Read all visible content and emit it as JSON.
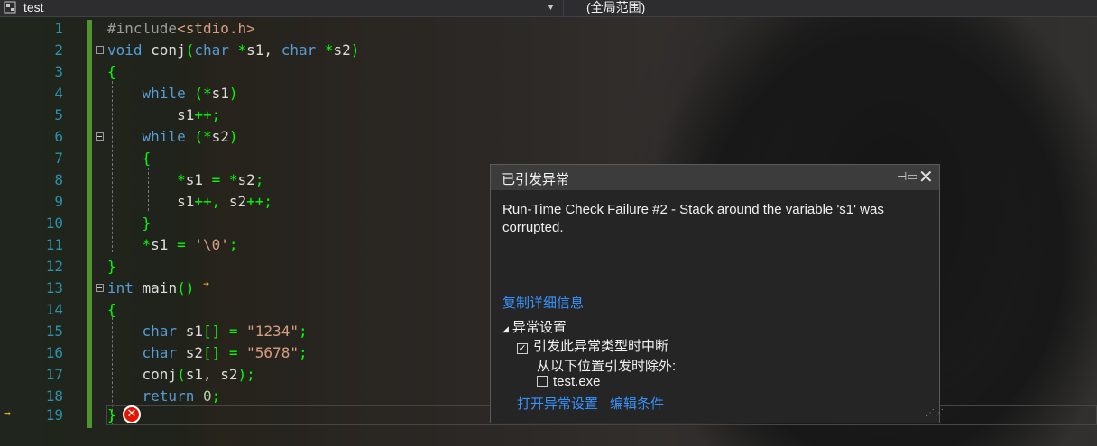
{
  "topbar": {
    "project_label": "test",
    "scope_label": "(全局范围)",
    "project_icon": "project-icon",
    "dropdown_icon": "chevron-down-icon"
  },
  "editor": {
    "line_numbers": [
      "1",
      "2",
      "3",
      "4",
      "5",
      "6",
      "7",
      "8",
      "9",
      "10",
      "11",
      "12",
      "13",
      "14",
      "15",
      "16",
      "17",
      "18",
      "19"
    ],
    "colors": {
      "keyword": "#569cd6",
      "string": "#d69d85",
      "line_number": "#2b91af",
      "operator": "#00ff00",
      "preprocessor": "#9b9b9b"
    }
  },
  "popup": {
    "title": "已引发异常",
    "pin_icon": "pin-icon",
    "close_icon": "close-icon",
    "message": "Run-Time Check Failure #2 - Stack around the variable 's1' was corrupted.",
    "copy_details": "复制详细信息",
    "exception_settings": "异常设置",
    "break_when_thrown": "引发此异常类型时中断",
    "except_when_from": "从以下位置引发时除外:",
    "module": "test.exe",
    "open_settings": "打开异常设置",
    "edit_conditions": "编辑条件"
  }
}
